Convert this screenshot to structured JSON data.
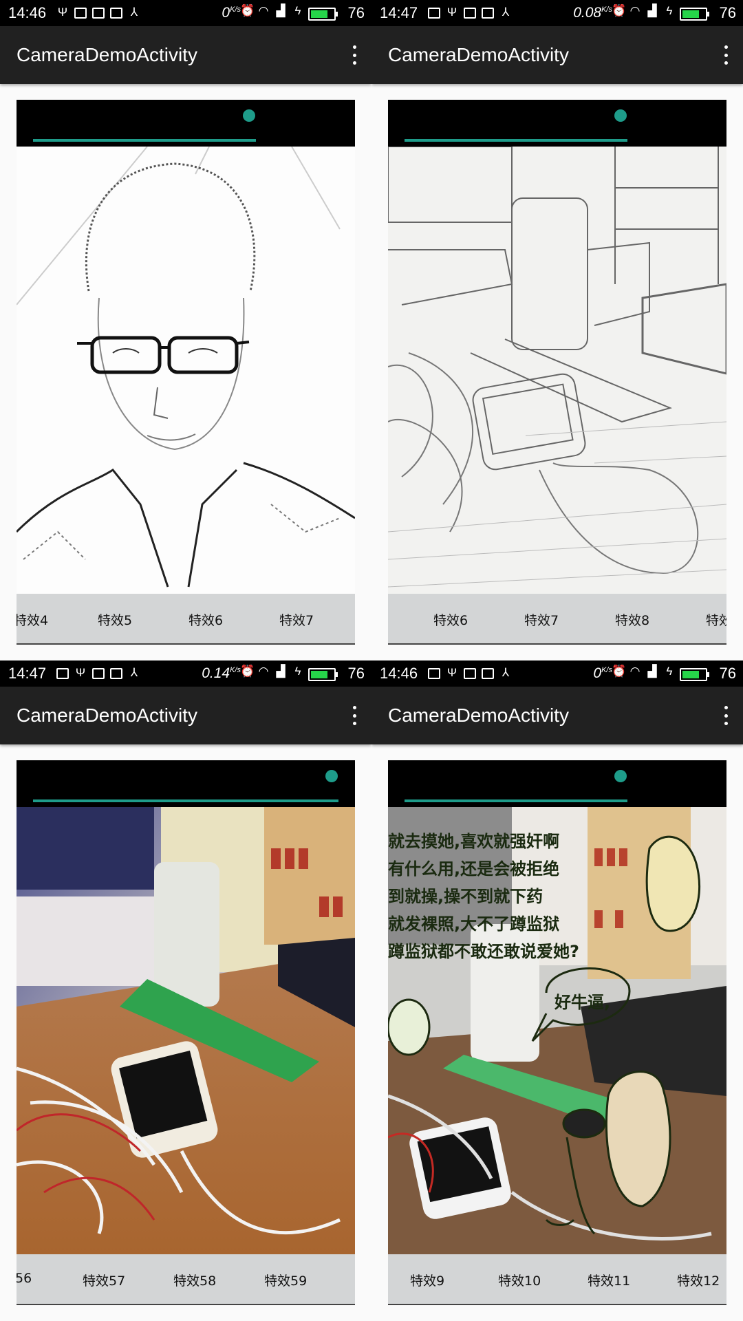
{
  "panels": [
    {
      "status": {
        "time": "14:46",
        "speed": "0",
        "speed_unit": "K/s",
        "battery": "76",
        "battery_level": 0.76
      },
      "appbar": {
        "title": "CameraDemoActivity"
      },
      "seekbar": {
        "value": 0.73
      },
      "photo": "sketch-portrait",
      "effects": [
        "特效4",
        "特效5",
        "特效6",
        "特效7"
      ]
    },
    {
      "status": {
        "time": "14:47",
        "speed": "0.08",
        "speed_unit": "K/s",
        "battery": "76",
        "battery_level": 0.76
      },
      "appbar": {
        "title": "CameraDemoActivity"
      },
      "seekbar": {
        "value": 0.73
      },
      "photo": "sketch-desk",
      "effects": [
        "特效6",
        "特效7",
        "特效8",
        "特效"
      ]
    },
    {
      "status": {
        "time": "14:47",
        "speed": "0.14",
        "speed_unit": "K/s",
        "battery": "76",
        "battery_level": 0.76
      },
      "appbar": {
        "title": "CameraDemoActivity"
      },
      "seekbar": {
        "value": 1.0
      },
      "photo": "color-desk",
      "effects": [
        "56",
        "特效57",
        "特效58",
        "特效59"
      ]
    },
    {
      "status": {
        "time": "14:46",
        "speed": "0",
        "speed_unit": "K/s",
        "battery": "76",
        "battery_level": 0.76
      },
      "appbar": {
        "title": "CameraDemoActivity"
      },
      "seekbar": {
        "value": 0.73
      },
      "photo": "meme-desk",
      "effects": [
        "特效9",
        "特效10",
        "特效11",
        "特效12"
      ],
      "meme_text": [
        "就去摸她,喜欢就强奸啊",
        "有什么用,还是会被拒绝",
        "到就操,操不到就下药",
        "就发裸照,大不了蹲监狱",
        "蹲监狱都不敢还敢说爱她?",
        "好牛逼,"
      ]
    }
  ],
  "colors": {
    "accent": "#1e9c8a",
    "appbar": "#212121",
    "effect_strip": "#d3d5d6",
    "battery": "#26d44a"
  }
}
